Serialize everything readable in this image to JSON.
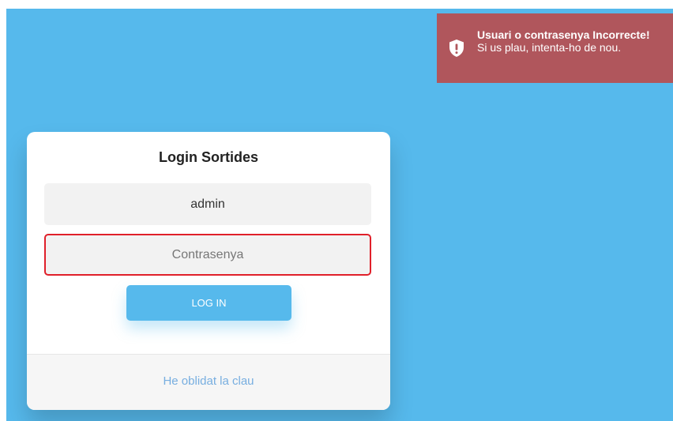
{
  "login": {
    "title": "Login Sortides",
    "username_value": "admin",
    "password_placeholder": "Contrasenya",
    "login_button_label": "LOG IN",
    "forgot_link_label": "He oblidat la clau"
  },
  "toast": {
    "title": "Usuari o contrasenya Incorrecte!",
    "message": "Si us plau, intenta-ho de nou.",
    "icon": "shield-icon"
  },
  "colors": {
    "background": "#56b9ec",
    "toast_background": "#b0565c",
    "error_border": "#e0202a",
    "link": "#77aee0"
  }
}
